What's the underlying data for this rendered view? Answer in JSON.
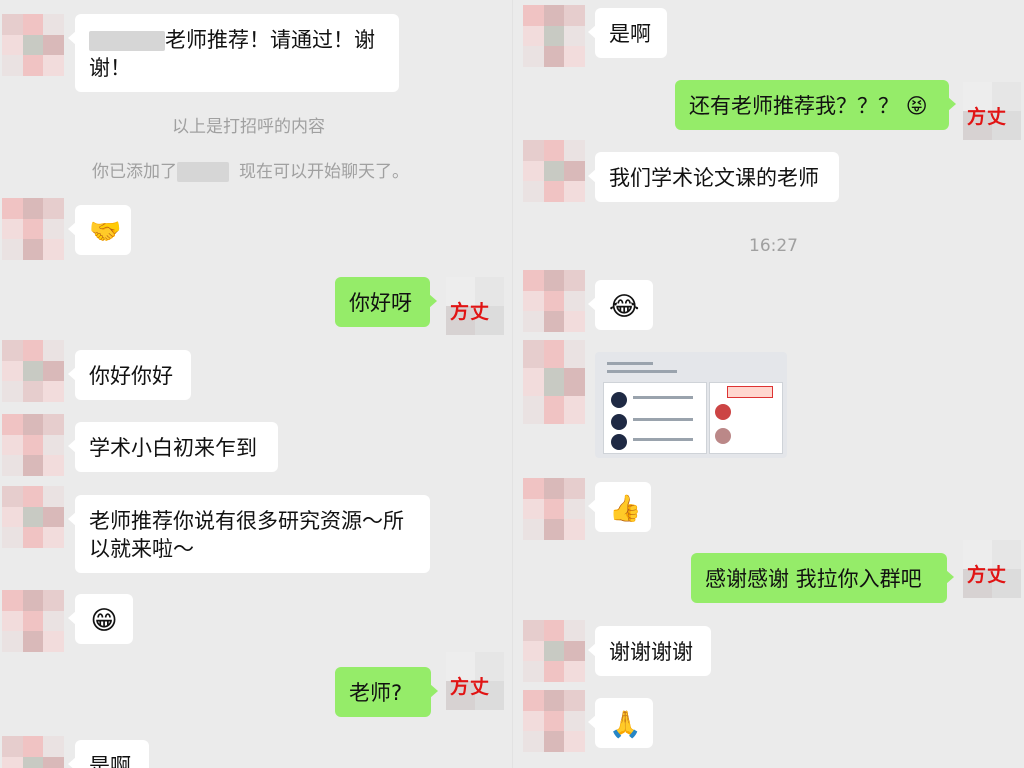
{
  "left": {
    "greeting_rest": "老师推荐！请通过！谢谢！",
    "sys_greeting": "以上是打招呼的内容",
    "sys_added_prefix": "你已添加了",
    "sys_added_suffix": "现在可以开始聊天了。",
    "emoji_1": "🤝",
    "me_1": "你好呀",
    "in_1": "你好你好",
    "in_2": "学术小白初来乍到",
    "in_3": "老师推荐你说有很多研究资源～所以就来啦～",
    "emoji_2": "😁",
    "me_2": "老师?",
    "in_4": "是啊"
  },
  "right": {
    "in_1": "是啊",
    "me_1": "还有老师推荐我？？？",
    "me_1_emoji": "😝",
    "in_2": "我们学术论文课的老师",
    "time": "16:27",
    "emoji_1": "😂",
    "emoji_2": "👍",
    "me_2": "感谢感谢 我拉你入群吧",
    "in_3": "谢谢谢谢",
    "emoji_3": "🙏"
  },
  "me_logo": "方丈",
  "colors": {
    "chat_bg": "#ebebeb",
    "incoming": "#ffffff",
    "outgoing": "#95ec69",
    "system_text": "#a0a0a0",
    "logo_red": "#e11414"
  }
}
